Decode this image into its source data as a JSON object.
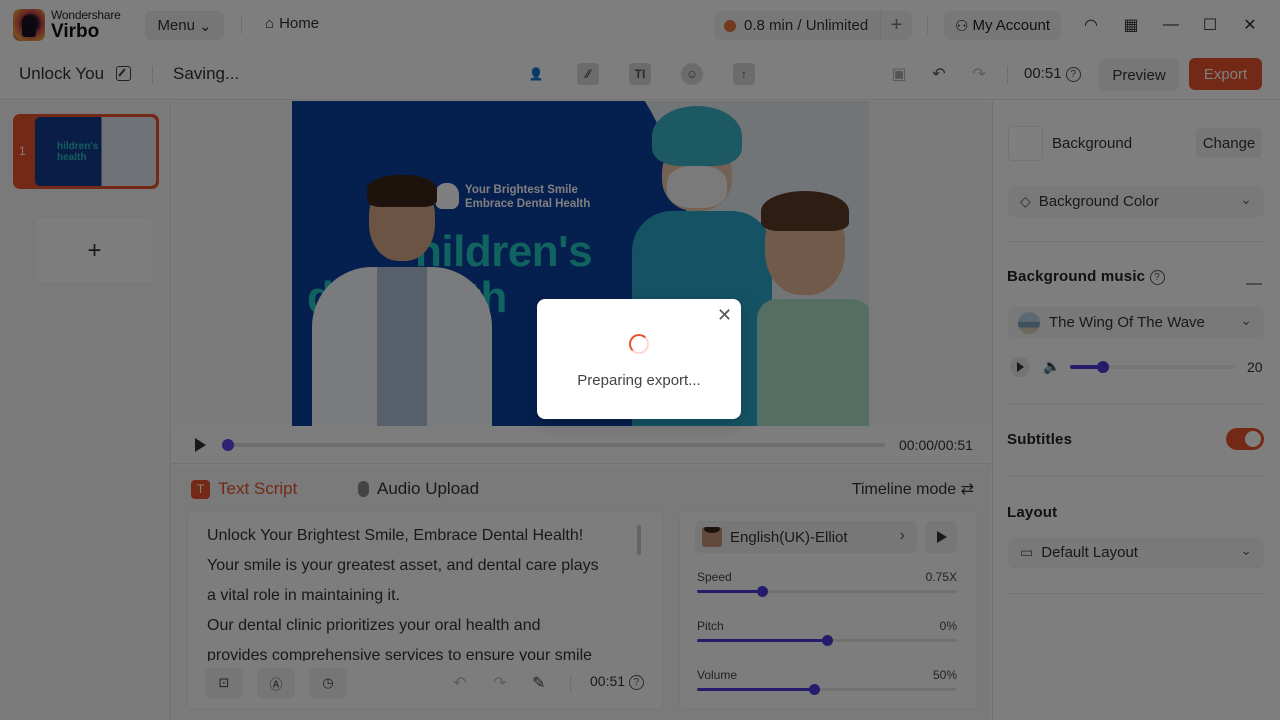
{
  "app": {
    "brand_small": "Wondershare",
    "brand_big": "Virbo",
    "menu_label": "Menu",
    "home_label": "Home",
    "credits_label": "0.8 min / Unlimited",
    "add_credits_icon": "plus-icon",
    "account_label": "My Account",
    "window_icons": [
      "headset-icon",
      "grid-icon",
      "minimize-icon",
      "maximize-icon",
      "close-icon"
    ]
  },
  "toolbar": {
    "project_name": "Unlock You",
    "status": "Saving...",
    "tool_icons": [
      "avatar-icon",
      "sticker-icon",
      "text-icon",
      "emoji-icon",
      "upload-icon"
    ],
    "duration": "00:51",
    "preview_label": "Preview",
    "export_label": "Export"
  },
  "slides": {
    "items": [
      {
        "number": "1",
        "thumb_text": "hildren's\nhealth"
      }
    ],
    "add_label": "+"
  },
  "canvas": {
    "tagline_line1": "Your Brightest Smile",
    "tagline_line2": "Embrace Dental Health",
    "headline_line1": "hildren's",
    "headline_line2": "d    health"
  },
  "playback": {
    "time": "00:00/00:51",
    "progress": 0
  },
  "script": {
    "tab_text_script": "Text Script",
    "tab_text_badge": "T",
    "tab_audio_upload": "Audio Upload",
    "timeline_mode": "Timeline mode ⇄",
    "lines": [
      "Unlock Your Brightest Smile, Embrace Dental Health!",
      "Your smile is your greatest asset, and dental care plays",
      "a vital role in maintaining it.",
      "Our dental clinic prioritizes your oral health and",
      "provides comprehensive services to ensure your smile"
    ],
    "duration": "00:51"
  },
  "voice": {
    "name": "English(UK)-Elliot",
    "sliders": [
      {
        "label": "Speed",
        "value": "0.75X",
        "fraction": 0.25
      },
      {
        "label": "Pitch",
        "value": "0%",
        "fraction": 0.5
      },
      {
        "label": "Volume",
        "value": "50%",
        "fraction": 0.45
      }
    ]
  },
  "right_panel": {
    "background_label": "Background",
    "change_label": "Change",
    "background_color_label": "Background Color",
    "music_title": "Background music",
    "music_track": "The Wing Of The Wave",
    "music_volume": "20",
    "music_volume_fraction": 0.2,
    "subtitles_title": "Subtitles",
    "subtitles_on": true,
    "layout_title": "Layout",
    "layout_value": "Default Layout"
  },
  "modal": {
    "message": "Preparing export...",
    "close_icon": "close-icon"
  },
  "colors": {
    "accent": "#e8522c",
    "slider": "#4a3ad8",
    "canvas_blue": "#0a3f9e",
    "headline_teal": "#22c7c0"
  }
}
